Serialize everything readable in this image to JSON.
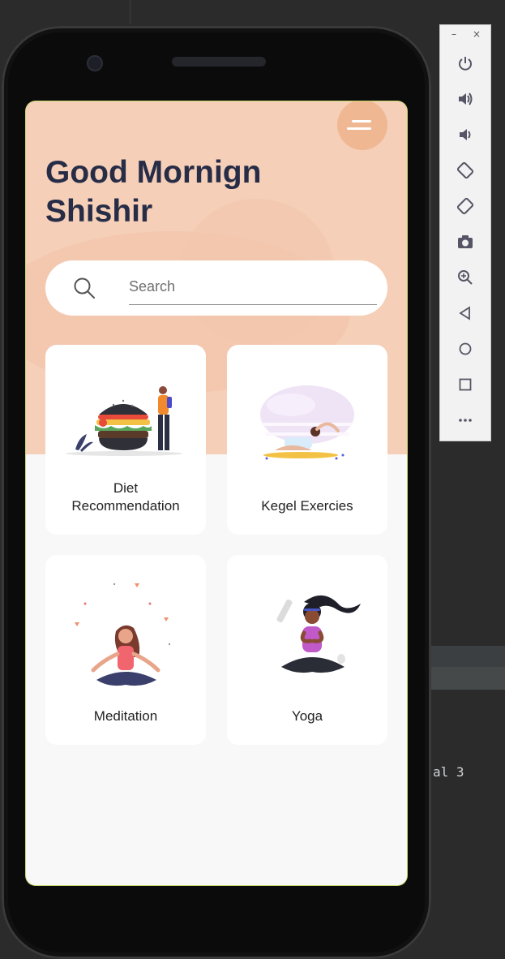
{
  "ide": {
    "code_fragment": "al 3"
  },
  "app": {
    "greeting_line1": "Good Mornign",
    "greeting_line2": "Shishir",
    "search": {
      "placeholder": "Search",
      "value": ""
    },
    "cards": [
      {
        "label_line1": "Diet",
        "label_line2": "Recommendation",
        "icon": "diet-illustration"
      },
      {
        "label_line1": "Kegel Exercies",
        "label_line2": "",
        "icon": "kegel-illustration"
      },
      {
        "label_line1": "Meditation",
        "label_line2": "",
        "icon": "meditation-illustration"
      },
      {
        "label_line1": "Yoga",
        "label_line2": "",
        "icon": "yoga-illustration"
      }
    ],
    "colors": {
      "hero": "#f5cfb8",
      "accent": "#f0b793",
      "title": "#272d46",
      "background": "#f8f8f8"
    }
  },
  "emulator_toolbar": {
    "minimize": "–",
    "close": "×",
    "buttons": [
      "power",
      "volume-up",
      "volume-down",
      "rotate-left",
      "rotate-right",
      "screenshot",
      "zoom",
      "back",
      "home",
      "overview",
      "more"
    ]
  }
}
